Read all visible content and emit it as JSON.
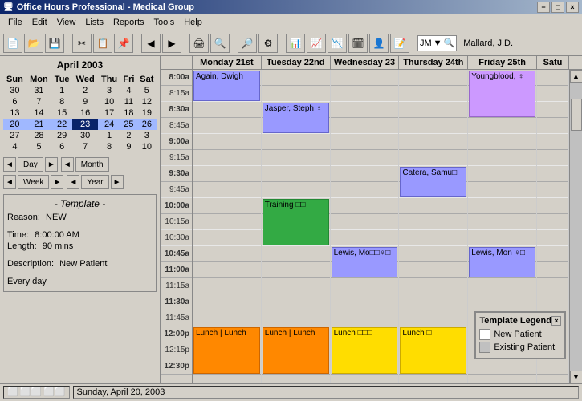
{
  "window": {
    "title": "Office Hours Professional - Medical Group",
    "minimize": "−",
    "maximize": "□",
    "close": "×"
  },
  "menu": {
    "items": [
      "File",
      "Edit",
      "View",
      "Lists",
      "Reports",
      "Tools",
      "Help"
    ]
  },
  "toolbar": {
    "combo_value": "JM",
    "provider_name": "Mallard, J.D."
  },
  "mini_calendar": {
    "title": "April 2003",
    "day_headers": [
      "Sun",
      "Mon",
      "Tue",
      "Wed",
      "Thu",
      "Fri",
      "Sat"
    ],
    "weeks": [
      [
        "30",
        "31",
        "1",
        "2",
        "3",
        "4",
        "5"
      ],
      [
        "6",
        "7",
        "8",
        "9",
        "10",
        "11",
        "12"
      ],
      [
        "13",
        "14",
        "15",
        "16",
        "17",
        "18",
        "19"
      ],
      [
        "20",
        "21",
        "22",
        "23",
        "24",
        "25",
        "26"
      ],
      [
        "27",
        "28",
        "29",
        "30",
        "1",
        "2",
        "3"
      ],
      [
        "4",
        "5",
        "6",
        "7",
        "8",
        "9",
        "10"
      ]
    ],
    "prev_month_days": [
      "30",
      "31"
    ],
    "next_month_days": [
      "1",
      "2",
      "3",
      "4",
      "5",
      "6",
      "7",
      "8",
      "9",
      "10"
    ],
    "today": "23",
    "selected_week": [
      "20",
      "21",
      "22",
      "23",
      "24",
      "25",
      "26"
    ]
  },
  "nav_buttons": {
    "day_label": "Day",
    "month_label": "Month",
    "week_label": "Week",
    "year_label": "Year"
  },
  "template": {
    "title": "- Template -",
    "reason_label": "Reason:",
    "reason_value": "NEW",
    "time_label": "Time:",
    "time_value": "8:00:00 AM",
    "length_label": "Length:",
    "length_value": "90 mins",
    "description_label": "Description:",
    "description_value": "New Patient",
    "recurrence_label": "Every day"
  },
  "calendar": {
    "day_headers": [
      {
        "label": "Monday 21st",
        "short": false
      },
      {
        "label": "Tuesday 22nd",
        "short": false
      },
      {
        "label": "Wednesday 23",
        "short": false
      },
      {
        "label": "Thursday 24th",
        "short": false
      },
      {
        "label": "Friday 25th",
        "short": false
      },
      {
        "label": "Satu",
        "short": true
      }
    ],
    "time_slots": [
      {
        "time": "8:00a",
        "major": true
      },
      {
        "time": "8:15a",
        "major": false
      },
      {
        "time": "8:30a",
        "major": true
      },
      {
        "time": "8:45a",
        "major": false
      },
      {
        "time": "9:00a",
        "major": true
      },
      {
        "time": "9:15a",
        "major": false
      },
      {
        "time": "9:30a",
        "major": true
      },
      {
        "time": "9:45a",
        "major": false
      },
      {
        "time": "10:00a",
        "major": true
      },
      {
        "time": "10:15a",
        "major": false
      },
      {
        "time": "10:30a",
        "major": false
      },
      {
        "time": "10:45a",
        "major": true
      },
      {
        "time": "11:00a",
        "major": true
      },
      {
        "time": "11:15a",
        "major": false
      },
      {
        "time": "11:30a",
        "major": true
      },
      {
        "time": "11:45a",
        "major": false
      },
      {
        "time": "12:00p",
        "major": true
      },
      {
        "time": "12:15p",
        "major": false
      },
      {
        "time": "12:30p",
        "major": true
      }
    ]
  },
  "appointments": [
    {
      "day": 0,
      "slot": 0,
      "height": 2,
      "text": "Again, Dwigh",
      "class": "appt-blue"
    },
    {
      "day": 1,
      "slot": 2,
      "height": 2,
      "text": "Jasper, Steph ♀",
      "class": "appt-blue"
    },
    {
      "day": 4,
      "slot": 0,
      "height": 3,
      "text": "Youngblood, ♀",
      "class": "appt-purple"
    },
    {
      "day": 3,
      "slot": 6,
      "height": 2,
      "text": "Catera, Samu□",
      "class": "appt-blue"
    },
    {
      "day": 1,
      "slot": 8,
      "height": 3,
      "text": "Training  □□",
      "class": "appt-green"
    },
    {
      "day": 2,
      "slot": 11,
      "height": 2,
      "text": "Lewis, Mo□□♀□",
      "class": "appt-blue"
    },
    {
      "day": 4,
      "slot": 11,
      "height": 2,
      "text": "Lewis, Mon ♀□",
      "class": "appt-blue"
    },
    {
      "day": 0,
      "slot": 16,
      "height": 3,
      "text": "Lunch | Lunch",
      "class": "appt-orange"
    },
    {
      "day": 1,
      "slot": 16,
      "height": 3,
      "text": "Lunch | Lunch",
      "class": "appt-orange"
    },
    {
      "day": 2,
      "slot": 16,
      "height": 3,
      "text": "Lunch  □□□",
      "class": "appt-yellow"
    },
    {
      "day": 3,
      "slot": 16,
      "height": 3,
      "text": "Lunch  □",
      "class": "appt-yellow"
    }
  ],
  "legend": {
    "title": "Template Legend",
    "items": [
      {
        "label": "New Patient",
        "swatch": "white"
      },
      {
        "label": "Existing Patient",
        "swatch": "gray"
      }
    ]
  },
  "status_bar": {
    "date": "Sunday, April 20, 2003"
  }
}
